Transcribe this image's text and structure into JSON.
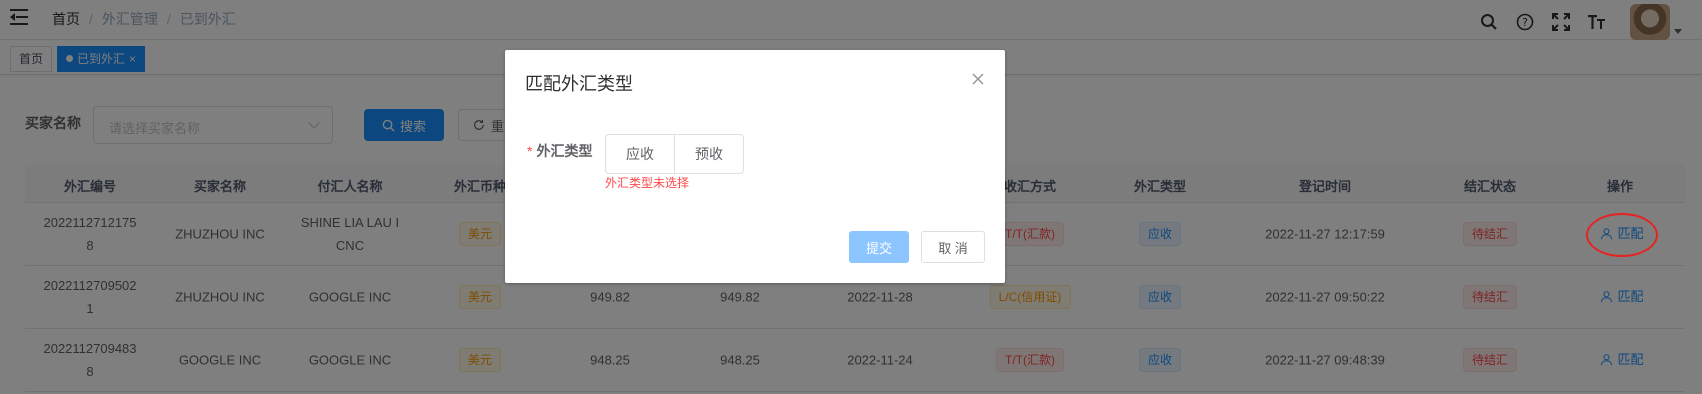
{
  "breadcrumb": [
    "首页",
    "外汇管理",
    "已到外汇"
  ],
  "header_icons": [
    "search-icon",
    "question-icon",
    "fullscreen-icon",
    "font-size-icon"
  ],
  "tags": {
    "home": "首页",
    "active": "已到外汇",
    "close": "×"
  },
  "search": {
    "label": "买家名称",
    "placeholder": "请选择买家名称",
    "search_btn": "搜索",
    "reset_btn": "重置"
  },
  "table": {
    "headers": [
      "外汇编号",
      "买家名称",
      "付汇人名称",
      "外汇币种",
      "",
      "",
      "",
      "收汇方式",
      "外汇类型",
      "登记时间",
      "结汇状态",
      "操作"
    ],
    "rows": [
      {
        "no_line1": "2022112712175",
        "no_line2": "8",
        "buyer": "ZHUZHOU INC",
        "payer_line1": "SHINE LIA LAU I",
        "payer_line2": "CNC",
        "currency": "美元",
        "amount1": "",
        "amount2": "",
        "date": "",
        "method": "T/T(汇款)",
        "type": "应收",
        "time": "2022-11-27 12:17:59",
        "status": "待结汇",
        "action": "匹配"
      },
      {
        "no_line1": "2022112709502",
        "no_line2": "1",
        "buyer": "ZHUZHOU INC",
        "payer_line1": "GOOGLE INC",
        "payer_line2": "",
        "currency": "美元",
        "amount1": "949.82",
        "amount2": "949.82",
        "date": "2022-11-28",
        "method": "L/C(信用证)",
        "type": "应收",
        "time": "2022-11-27 09:50:22",
        "status": "待结汇",
        "action": "匹配"
      },
      {
        "no_line1": "2022112709483",
        "no_line2": "8",
        "buyer": "GOOGLE INC",
        "payer_line1": "GOOGLE INC",
        "payer_line2": "",
        "currency": "美元",
        "amount1": "948.25",
        "amount2": "948.25",
        "date": "2022-11-24",
        "method": "T/T(汇款)",
        "type": "应收",
        "time": "2022-11-27 09:48:39",
        "status": "待结汇",
        "action": "匹配"
      }
    ]
  },
  "dialog": {
    "title": "匹配外汇类型",
    "field_label": "外汇类型",
    "required_mark": "*",
    "options": [
      "应收",
      "预收"
    ],
    "error": "外汇类型未选择",
    "submit": "提交",
    "cancel": "取 消"
  },
  "colors": {
    "primary": "#1890ff",
    "danger": "#ff4949",
    "warning": "#ff9900",
    "annotation": "#e52421"
  }
}
